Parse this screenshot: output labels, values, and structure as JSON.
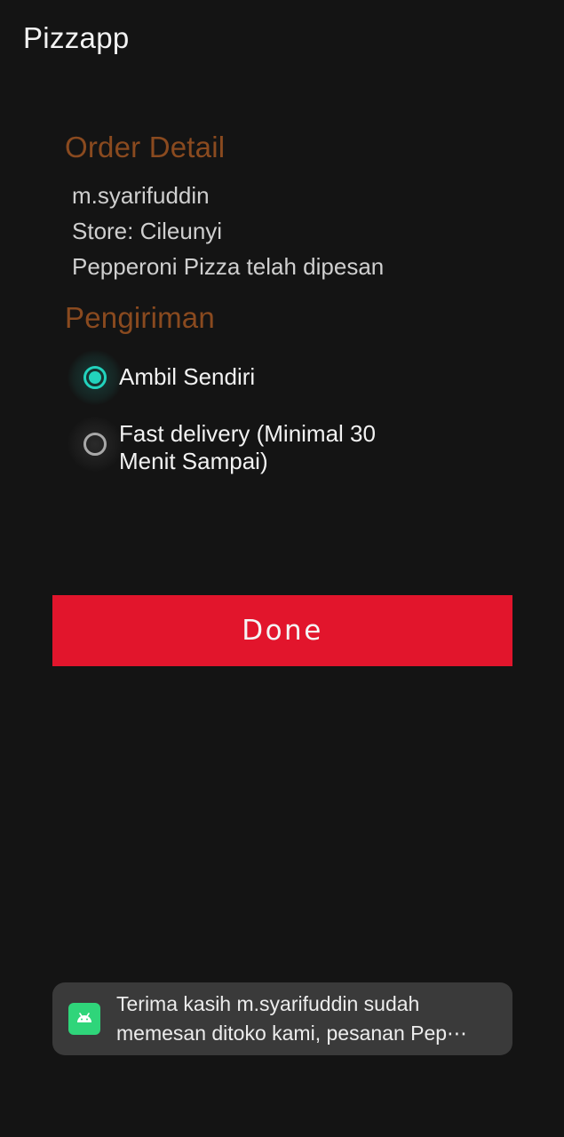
{
  "app": {
    "title": "Pizzapp"
  },
  "order_detail": {
    "title": "Order Detail",
    "customer": "m.syarifuddin",
    "store": "Store: Cileunyi",
    "message": "Pepperoni Pizza telah dipesan"
  },
  "shipping": {
    "title": "Pengiriman",
    "options": [
      {
        "label": "Ambil Sendiri",
        "selected": true
      },
      {
        "label_line1": "Fast delivery (Minimal 30",
        "label_line2": "Menit Sampai)",
        "selected": false
      }
    ]
  },
  "actions": {
    "done_label": "Done"
  },
  "toast": {
    "icon": "android-icon",
    "line1": "Terima kasih m.syarifuddin sudah",
    "line2": "memesan ditoko kami, pesanan Pep⋯"
  },
  "colors": {
    "background": "#141414",
    "section_title": "#8a4a1f",
    "accent_radio": "#22d3bd",
    "done_button": "#e2152c",
    "toast_background": "#3a3a3a",
    "toast_icon": "#2fd57a"
  }
}
